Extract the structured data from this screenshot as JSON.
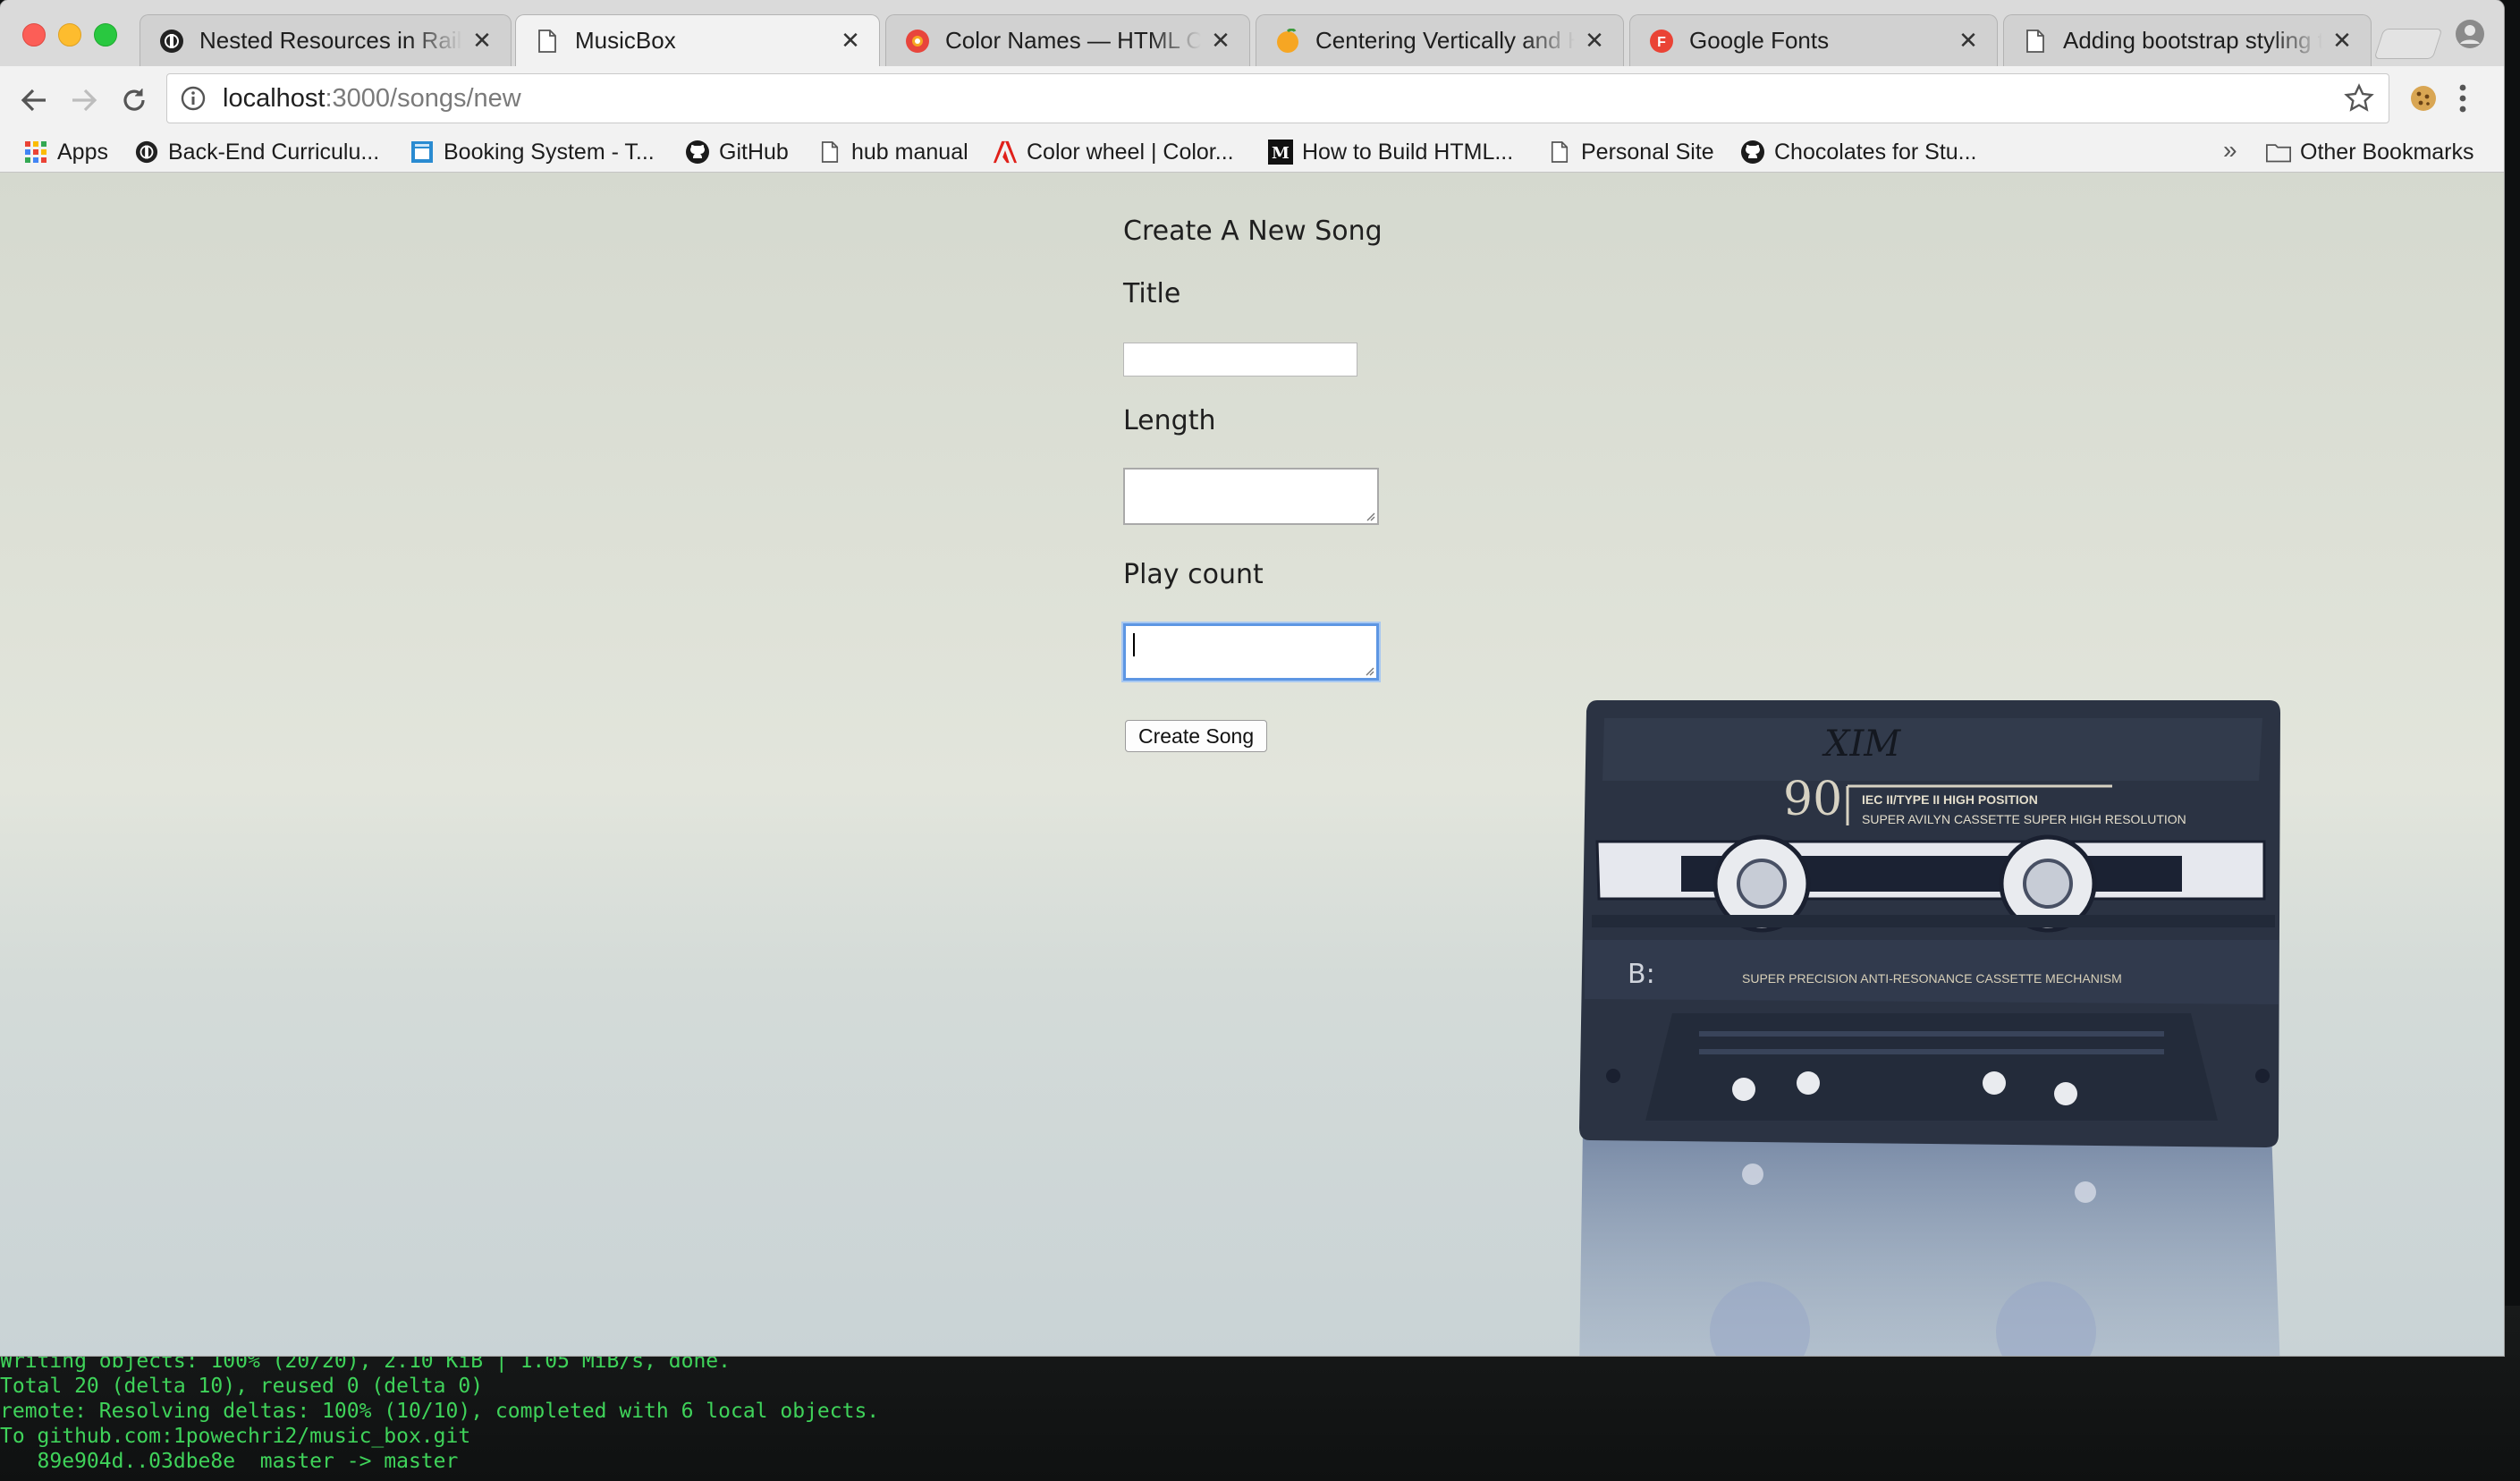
{
  "terminal": {
    "lines": [
      "Writing objects: 100% (20/20), 2.10 KiB | 1.05 MiB/s, done.",
      "Total 20 (delta 10), reused 0 (delta 0)",
      "remote: Resolving deltas: 100% (10/10), completed with 6 local objects.",
      "To github.com:1powechri2/music_box.git",
      "   89e904d..03dbe8e  master -> master"
    ]
  },
  "browser": {
    "tabs": [
      {
        "title": "Nested Resources in Rails",
        "icon": "turing-icon",
        "active": false
      },
      {
        "title": "MusicBox",
        "icon": "document-icon",
        "active": true
      },
      {
        "title": "Color Names — HTML Color Codes",
        "icon": "color-wheel-icon",
        "active": false
      },
      {
        "title": "Centering Vertically and Horizontally",
        "icon": "orange-icon",
        "active": false
      },
      {
        "title": "Google Fonts",
        "icon": "google-fonts-icon",
        "active": false
      },
      {
        "title": "Adding bootstrap styling to",
        "icon": "document-icon",
        "active": false
      }
    ],
    "url": {
      "host": "localhost",
      "path": ":3000/songs/new"
    },
    "bookmarks": [
      {
        "label": "Apps",
        "icon": "apps-grid-icon"
      },
      {
        "label": "Back-End Curriculu...",
        "icon": "turing-icon"
      },
      {
        "label": "Booking System - T...",
        "icon": "calendar-icon"
      },
      {
        "label": "GitHub",
        "icon": "github-icon"
      },
      {
        "label": "hub manual",
        "icon": "document-icon"
      },
      {
        "label": "Color wheel | Color...",
        "icon": "adobe-icon"
      },
      {
        "label": "How to Build HTML...",
        "icon": "medium-icon"
      },
      {
        "label": "Personal Site",
        "icon": "document-icon"
      },
      {
        "label": "Chocolates for Stu...",
        "icon": "github-icon"
      }
    ],
    "other_bookmarks": "Other Bookmarks",
    "more_bookmarks": "»"
  },
  "form": {
    "heading": "Create A New Song",
    "title_label": "Title",
    "length_label": "Length",
    "play_count_label": "Play count",
    "title_value": "",
    "length_value": "",
    "play_count_value": "",
    "submit_label": "Create Song"
  },
  "cassette": {
    "label_number": "90",
    "label_type": "IEC II/TYPE II HIGH POSITION",
    "label_sub": "SUPER AVILYN CASSETTE SUPER HIGH RESOLUTION",
    "side": "B:",
    "mechanism": "SUPER PRECISION ANTI-RESONANCE CASSETTE MECHANISM",
    "handwriting": "XIM"
  },
  "colors": {
    "focus_ring": "#5d96e3",
    "terminal_text": "#3fd35a",
    "page_background": "#dfe2d8",
    "cassette_body": "#2a3342"
  }
}
